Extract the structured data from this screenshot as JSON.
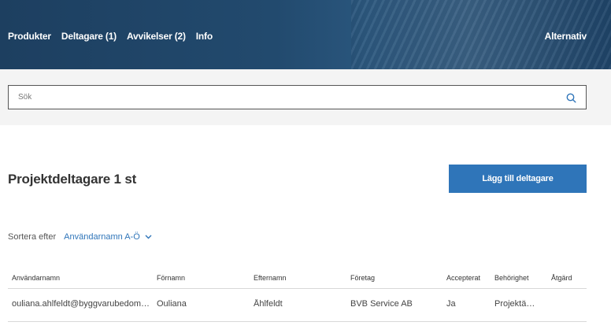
{
  "nav": {
    "items": [
      "Produkter",
      "Deltagare (1)",
      "Avvikelser (2)",
      "Info"
    ],
    "alternativ": "Alternativ"
  },
  "search": {
    "placeholder": "Sök",
    "icon": "search-icon"
  },
  "participants": {
    "title": "Projektdeltagare 1 st",
    "add_button": "Lägg till deltagare"
  },
  "sort": {
    "label": "Sortera efter",
    "selected": "Användarnamn A-Ö"
  },
  "table": {
    "headers": [
      "Användarnamn",
      "Förnamn",
      "Efternamn",
      "Företag",
      "Accepterat",
      "Behörighet",
      "Åtgärd"
    ],
    "rows": [
      [
        "ouliana.ahlfeldt@byggvarubedom…",
        "Ouliana",
        "Åhlfeldt",
        "BVB Service AB",
        "Ja",
        "Projektä…",
        ""
      ]
    ]
  },
  "colors": {
    "header_bg": "#1d3f60",
    "accent": "#2f75b9",
    "search_band": "#f4f4f4"
  }
}
